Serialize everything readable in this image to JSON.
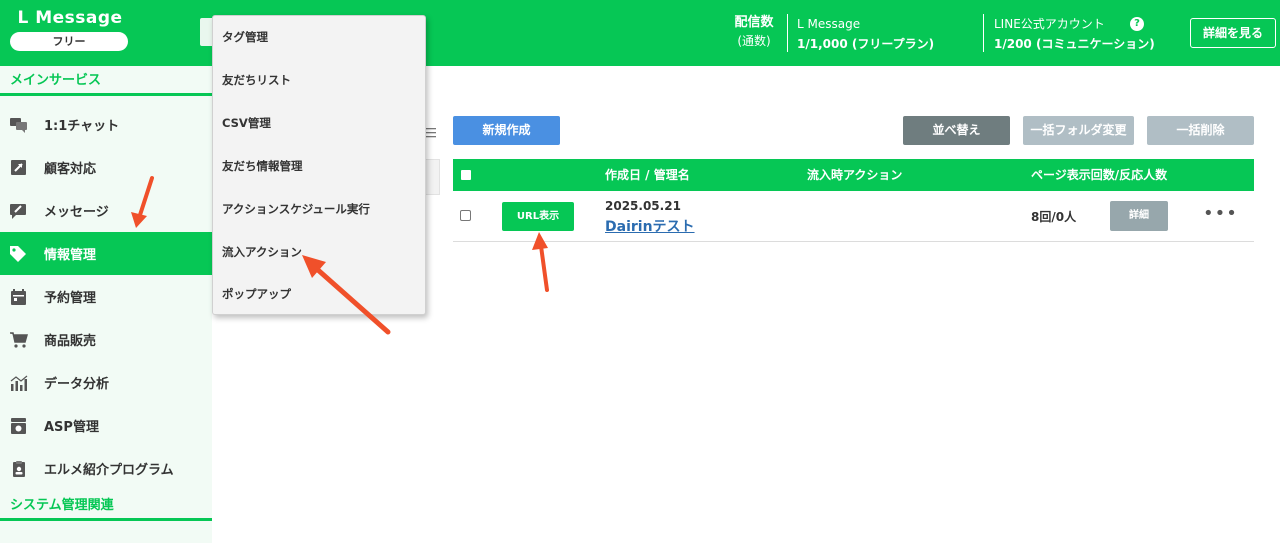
{
  "header": {
    "brand": "L Message",
    "plan": "フリー",
    "delivery_label": "配信数",
    "delivery_sub": "(通数)",
    "lmessage_label": "L Message",
    "lmessage_value": "1/1,000 (フリープラン)",
    "line_label": "LINE公式アカウント",
    "line_value": "1/200 (コミュニケーション)",
    "help_icon": "?",
    "detail_button": "詳細を見る"
  },
  "sidebar": {
    "section_main": "メインサービス",
    "section_system": "システム管理関連",
    "items": [
      {
        "label": "1:1チャット",
        "icon": "chat-icon"
      },
      {
        "label": "顧客対応",
        "icon": "arrow-box-icon"
      },
      {
        "label": "メッセージ",
        "icon": "message-edit-icon"
      },
      {
        "label": "情報管理",
        "icon": "tag-icon"
      },
      {
        "label": "予約管理",
        "icon": "calendar-icon"
      },
      {
        "label": "商品販売",
        "icon": "cart-icon"
      },
      {
        "label": "データ分析",
        "icon": "chart-icon"
      },
      {
        "label": "ASP管理",
        "icon": "asp-icon"
      },
      {
        "label": "エルメ紹介プログラム",
        "icon": "badge-icon"
      }
    ],
    "active_item": "情報管理"
  },
  "dropdown": {
    "items": [
      "タグ管理",
      "友だちリスト",
      "CSV管理",
      "友だち情報管理",
      "アクションスケジュール実行",
      "流入アクション",
      "ポップアップ"
    ]
  },
  "toolbar": {
    "new": "新規作成",
    "sort": "並べ替え",
    "folder_change": "一括フォルダ変更",
    "delete_all": "一括削除"
  },
  "table": {
    "columns": [
      "作成日 / 管理名",
      "流入時アクション",
      "ページ表示回数/反応人数"
    ],
    "rows": [
      {
        "url_button": "URL表示",
        "date": "2025.05.21",
        "name": "Dairinテスト",
        "action": "",
        "count": "8回/0人",
        "detail_button": "詳細",
        "more": "•••"
      }
    ]
  },
  "colors": {
    "accent": "#06c755",
    "new_button": "#4a90e2",
    "sort_button": "#6f7d7f",
    "disabled_button": "#b0bec5",
    "annotation_arrow": "#f0502a"
  }
}
